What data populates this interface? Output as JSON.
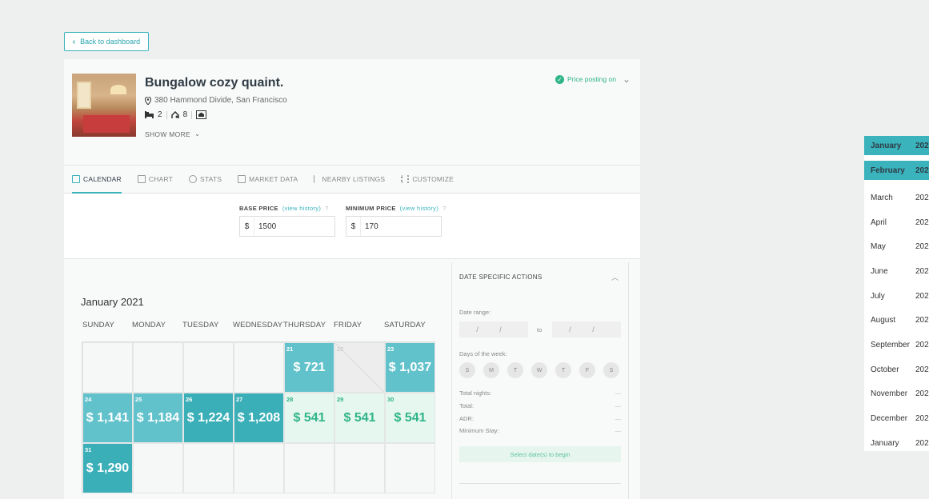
{
  "back_button": {
    "label": "Back to dashboard"
  },
  "listing": {
    "title": "Bungalow cozy quaint.",
    "address": "380 Hammond Divide, San Francisco",
    "beds": "2",
    "guests": "8",
    "show_more": "SHOW MORE"
  },
  "price_posting": {
    "label": "Price posting on"
  },
  "tabs": [
    {
      "label": "CALENDAR",
      "icon": "calendar-icon",
      "active": true
    },
    {
      "label": "CHART",
      "icon": "chart-icon"
    },
    {
      "label": "STATS",
      "icon": "stats-icon"
    },
    {
      "label": "MARKET DATA",
      "icon": "market-data-icon"
    },
    {
      "label": "NEARBY LISTINGS",
      "icon": "nearby-listings-icon"
    },
    {
      "label": "CUSTOMIZE",
      "icon": "customize-icon"
    }
  ],
  "base_price": {
    "label": "BASE PRICE",
    "history": "(view history)",
    "help": "?",
    "currency": "$",
    "value": "1500"
  },
  "minimum_price": {
    "label": "MINIMUM PRICE",
    "history": "(view history)",
    "help": "?",
    "currency": "$",
    "value": "170"
  },
  "calendar": {
    "month": "January 2021",
    "weekdays": [
      "SUNDAY",
      "MONDAY",
      "TUESDAY",
      "WEDNESDAY",
      "THURSDAY",
      "FRIDAY",
      "SATURDAY"
    ],
    "days": [
      {
        "day": "21",
        "price": "$ 721"
      },
      {
        "day": "22",
        "price": ""
      },
      {
        "day": "23",
        "price": "$ 1,037"
      },
      {
        "day": "24",
        "price": "$ 1,141"
      },
      {
        "day": "25",
        "price": "$ 1,184"
      },
      {
        "day": "26",
        "price": "$ 1,224"
      },
      {
        "day": "27",
        "price": "$ 1,208"
      },
      {
        "day": "28",
        "price": "$ 541"
      },
      {
        "day": "29",
        "price": "$ 541"
      },
      {
        "day": "30",
        "price": "$ 541"
      },
      {
        "day": "31",
        "price": "$ 1,290"
      }
    ]
  },
  "date_actions": {
    "title": "DATE SPECIFIC ACTIONS",
    "date_range_label": "Date range:",
    "date_placeholder": "/ /",
    "to": "to",
    "days_label": "Days of the week:",
    "days": [
      "S",
      "M",
      "T",
      "W",
      "T",
      "F",
      "S"
    ],
    "total_nights": "Total nights:",
    "total": "Total:",
    "adr": "ADR:",
    "minimum_stay": "Minimum Stay:",
    "empty_value": "—",
    "select_button": "Select date(s) to begin"
  },
  "month_list": [
    {
      "month": "January",
      "year": "202"
    },
    {
      "month": "February",
      "year": "202"
    },
    {
      "month": "March",
      "year": "202"
    },
    {
      "month": "April",
      "year": "202"
    },
    {
      "month": "May",
      "year": "202"
    },
    {
      "month": "June",
      "year": "202"
    },
    {
      "month": "July",
      "year": "202"
    },
    {
      "month": "August",
      "year": "202"
    },
    {
      "month": "September",
      "year": "202"
    },
    {
      "month": "October",
      "year": "202"
    },
    {
      "month": "November",
      "year": "202"
    },
    {
      "month": "December",
      "year": "202"
    },
    {
      "month": "January",
      "year": "202"
    }
  ],
  "colors": {
    "accent": "#3ab3bd",
    "success": "#2fb489",
    "teal_light": "#62c2cb",
    "green_bg": "#e6f7ef"
  }
}
